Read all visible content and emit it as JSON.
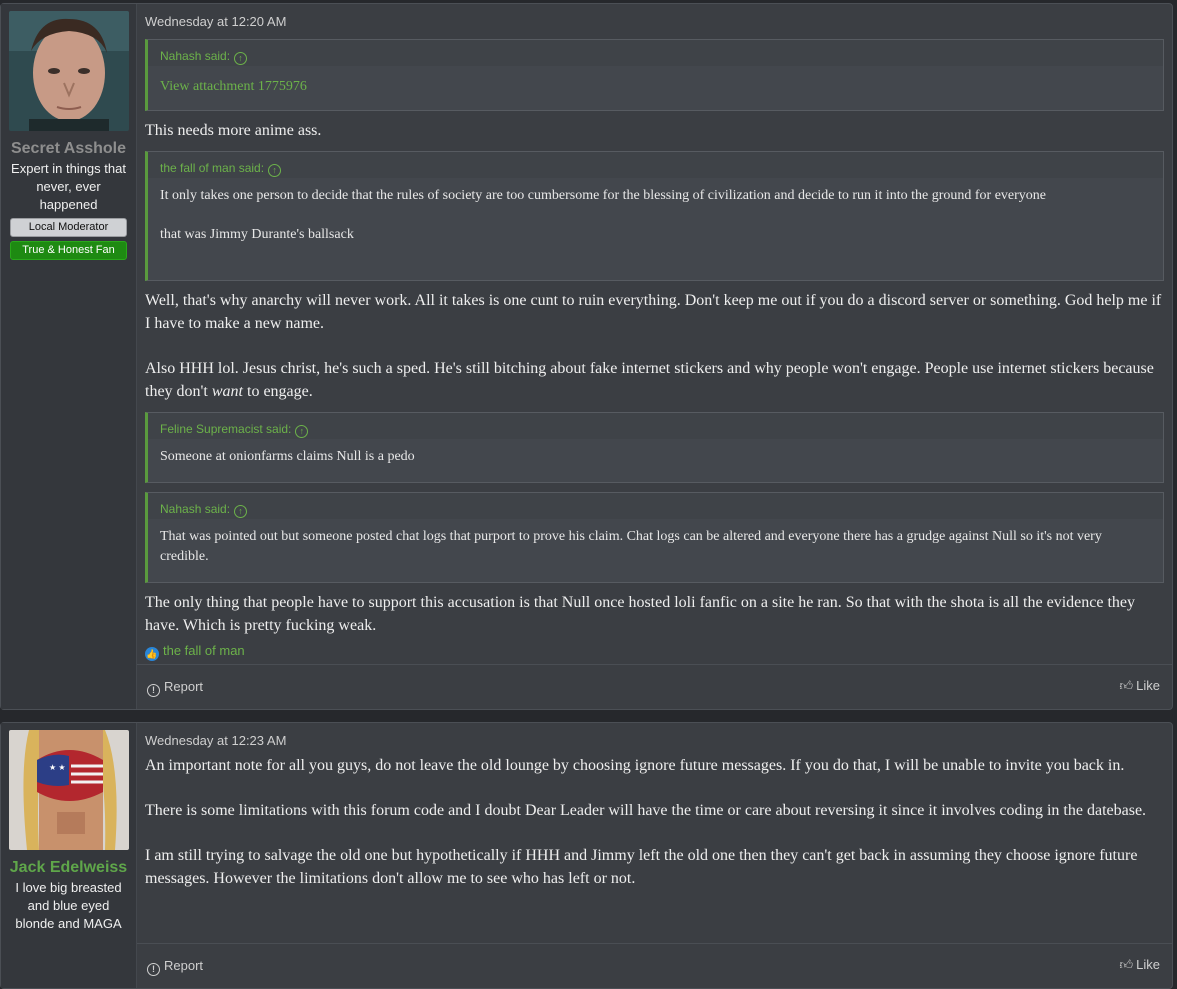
{
  "posts": [
    {
      "user": {
        "name": "Secret Asshole",
        "name_color": "#8e8e8e",
        "title": "Expert in things that never, ever happened",
        "badges": [
          "Local Moderator",
          "True & Honest Fan"
        ]
      },
      "date": "Wednesday at 12:20 AM",
      "quote1": {
        "author": "Nahash said:",
        "attachment": "View attachment 1775976"
      },
      "text1": "This needs more anime ass.",
      "quote2": {
        "author": "the fall of man said:",
        "line1": "It only takes one person to decide that the rules of society are too cumbersome for the blessing of civilization and decide to run it into the ground for everyone",
        "line2": "that was Jimmy Durante's ballsack"
      },
      "text2": "Well, that's why anarchy will never work. All it takes is one cunt to ruin everything. Don't keep me out if you do a discord server or something. God help me if I have to make a new name.",
      "text3_a": "Also HHH lol. Jesus christ, he's such a sped. He's still bitching about fake internet stickers and why people won't engage. People use internet stickers because they don't ",
      "text3_em": "want",
      "text3_b": " to engage.",
      "quote3": {
        "author": "Feline Supremacist said:",
        "line1": "Someone at onionfarms claims Null is a pedo"
      },
      "quote4": {
        "author": "Nahash said:",
        "line1": "That was pointed out but someone posted chat logs that purport to prove his claim. Chat logs can be altered and everyone there has a grudge against Null so it's not very credible."
      },
      "text4": "The only thing that people have to support this accusation is that Null once hosted loli fanfic on a site he ran. So that with the shota is all the evidence they have. Which is pretty fucking weak.",
      "reaction_user": "the fall of man",
      "report": "Report",
      "like": "Like"
    },
    {
      "user": {
        "name": "Jack Edelweiss",
        "name_color": "#5fa64a",
        "title": "I love big breasted and blue eyed blonde and MAGA"
      },
      "date": "Wednesday at 12:23 AM",
      "text1": "An important note for all you guys, do not leave the old lounge by choosing ignore future messages. If you do that, I will be unable to invite you back in.",
      "text2": "There is some limitations with this forum code and I doubt Dear Leader will have the time or care about reversing it since it involves coding in the datebase.",
      "text3": "I am still trying to salvage the old one but hypothetically if HHH and Jimmy left the old one then they can't get back in assuming they choose ignore future messages. However the limitations don't allow me to see who has left or not.",
      "report": "Report",
      "like": "Like"
    }
  ]
}
